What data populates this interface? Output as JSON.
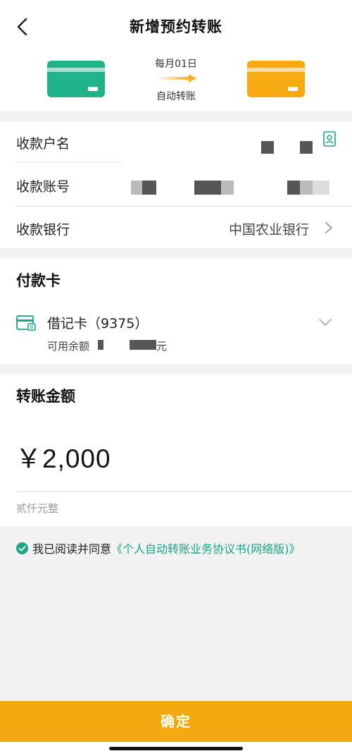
{
  "header": {
    "title": "新增预约转账",
    "back_icon": "chevron-left-icon"
  },
  "transfer_visual": {
    "schedule_line1": "每月01日",
    "schedule_line2": "自动转账",
    "from_card_color": "#20b38a",
    "to_card_color": "#f6a910"
  },
  "payee": {
    "name_label": "收款户名",
    "account_label": "收款账号",
    "bank_label": "收款银行",
    "bank_value": "中国农业银行"
  },
  "payment_card": {
    "title": "付款卡",
    "card_name": "借记卡（9375）",
    "balance_label": "可用余额",
    "balance_unit": "元"
  },
  "amount": {
    "title": "转账金额",
    "value": "￥2,000",
    "in_words": "贰仟元整"
  },
  "agreement": {
    "prefix": "我已阅读并同意",
    "link": "《个人自动转账业务协议书(网络版)》"
  },
  "footer": {
    "confirm_label": "确定"
  },
  "colors": {
    "accent_green": "#1aa584",
    "accent_orange": "#f5a911"
  }
}
